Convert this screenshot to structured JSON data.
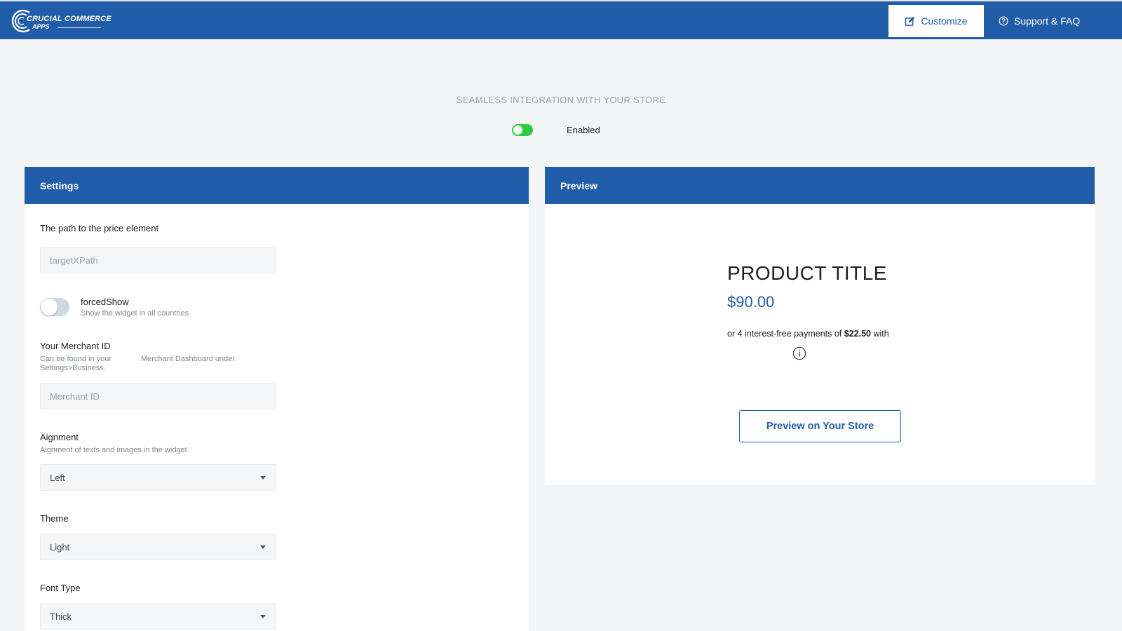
{
  "topbar": {
    "logo_line1": "CRUCIAL COMMERCE",
    "logo_line2": "APPS",
    "customize_label": "Customize",
    "support_label": "Support & FAQ"
  },
  "header": {
    "integration_title": "SEAMLESS INTEGRATION WITH YOUR STORE",
    "toggle_label": "Enabled",
    "toggle_on": true
  },
  "settings": {
    "title": "Settings",
    "price_path": {
      "label": "The path to the price element",
      "placeholder": "targetXPath",
      "value": ""
    },
    "forced_show": {
      "label": "forcedShow",
      "help": "Show the widget in all countries",
      "on": false
    },
    "merchant_id": {
      "label": "Your Merchant ID",
      "help_part1": "Can be found in your",
      "help_part2": "Settings>Business.",
      "help_part3": "Merchant Dashboard under",
      "placeholder": "Merchant ID",
      "value": ""
    },
    "alignment": {
      "label": "Aignment",
      "help": "Aignment of texts and images in the widget",
      "value": "Left"
    },
    "theme": {
      "label": "Theme",
      "value": "Light"
    },
    "font_type": {
      "label": "Font Type",
      "value": "Thick"
    }
  },
  "preview": {
    "title": "Preview",
    "product_title": "PRODUCT TITLE",
    "price": "$90.00",
    "installments_prefix": "or 4 interest-free payments of ",
    "installment_amount": "$22.50",
    "installments_suffix": " with",
    "button_label": "Preview on Your Store"
  },
  "colors": {
    "primary": "#205ca8",
    "toggle_on": "#2ecc40",
    "background": "#f4f5f7"
  }
}
